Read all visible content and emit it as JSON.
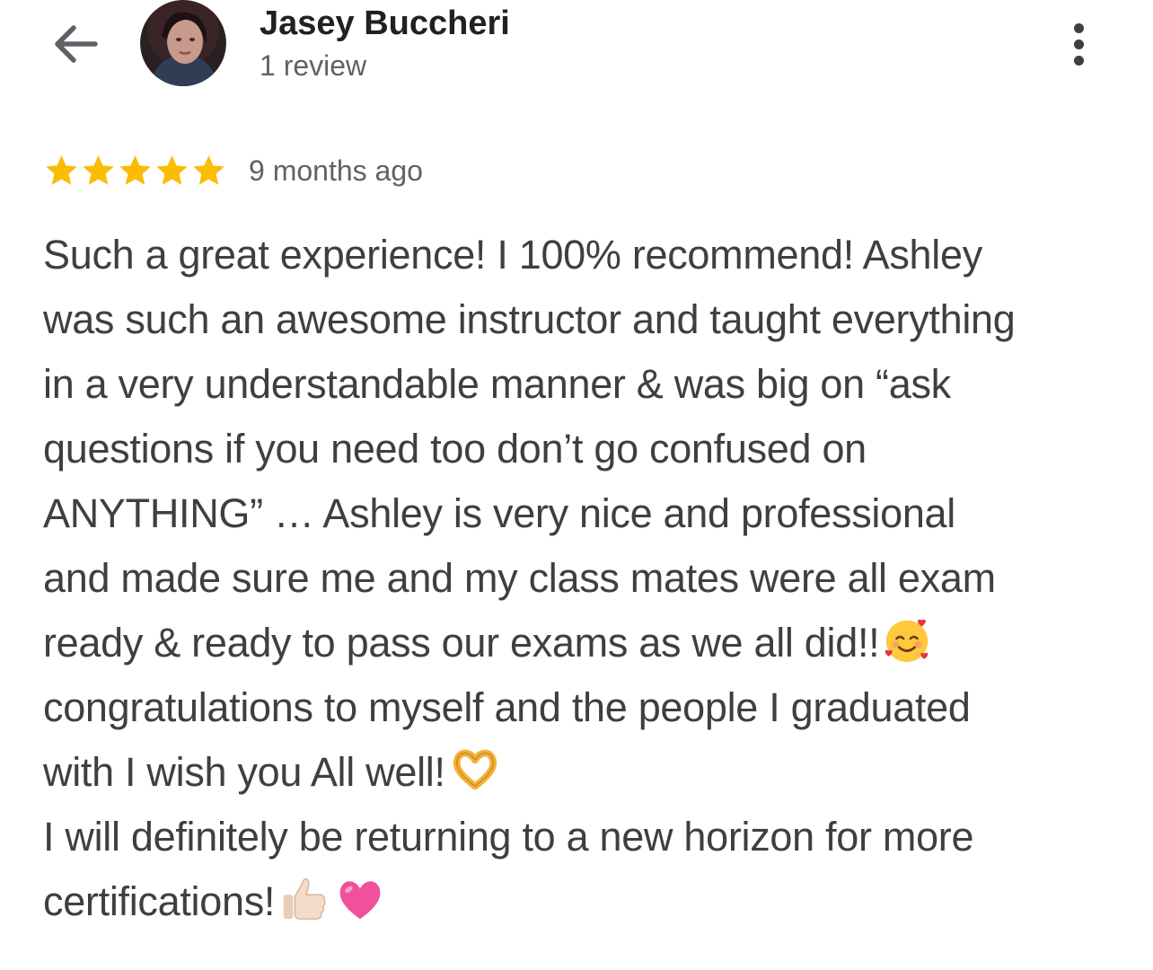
{
  "header": {
    "back_icon": "arrow-left-icon",
    "reviewer_name": "Jasey Buccheri",
    "review_count": "1 review",
    "more_icon": "more-vert-icon"
  },
  "review": {
    "rating": 5,
    "rating_max": 5,
    "star_color": "#FBBC04",
    "date": "9 months ago",
    "lines": [
      {
        "text": "Such a great experience! I 100% recommend! Ashley",
        "emoji": []
      },
      {
        "text": "was such an awesome instructor and taught everything",
        "emoji": []
      },
      {
        "text": "in a very understandable manner & was big on “ask",
        "emoji": []
      },
      {
        "text": "questions if you need too don’t go confused on",
        "emoji": []
      },
      {
        "text": "ANYTHING” … Ashley is very nice and professional",
        "emoji": []
      },
      {
        "text": "and made sure me and my class mates were all exam",
        "emoji": []
      },
      {
        "text": "ready & ready to pass our exams as we all did!!",
        "emoji": [
          "smiling-face-with-hearts-icon"
        ]
      },
      {
        "text": "congratulations to myself and the people I graduated",
        "emoji": []
      },
      {
        "text": "with I wish you All well!",
        "emoji": [
          "heart-hands-icon"
        ]
      },
      {
        "text": "I will definitely be returning to a new horizon for more",
        "emoji": []
      },
      {
        "text": "certifications!",
        "emoji": [
          "thumbs-up-icon",
          "pink-heart-icon"
        ]
      }
    ]
  }
}
